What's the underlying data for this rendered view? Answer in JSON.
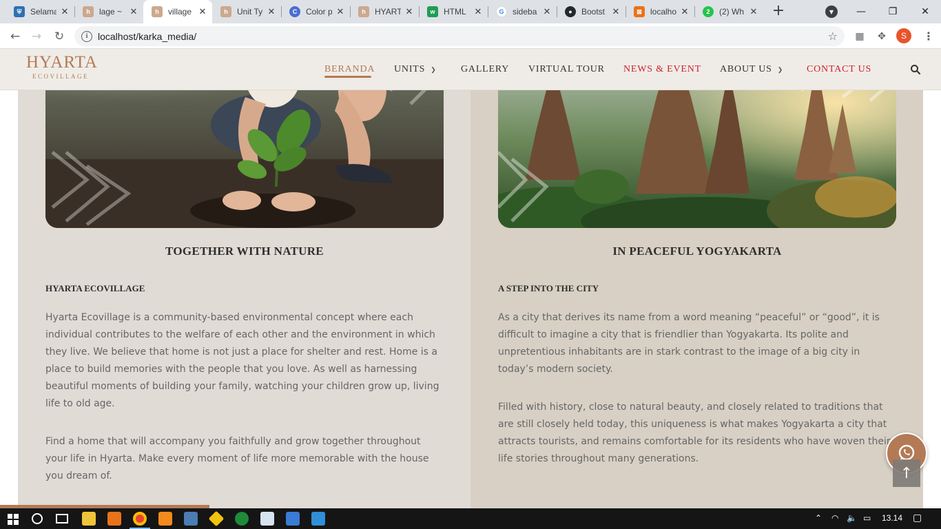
{
  "browser": {
    "tabs": [
      {
        "label": "Selama",
        "favicon_color": "#2f6fb3",
        "favicon_icon": "shield-icon"
      },
      {
        "label": "lage ~",
        "favicon_color": "#caa98f",
        "favicon_icon": "site-logo-icon"
      },
      {
        "label": "village",
        "favicon_color": "#caa98f",
        "favicon_icon": "site-logo-icon",
        "active": true
      },
      {
        "label": "Unit Ty",
        "favicon_color": "#caa98f",
        "favicon_icon": "site-logo-icon"
      },
      {
        "label": "Color p",
        "favicon_color": "#4b6cd4",
        "favicon_icon": "c-icon"
      },
      {
        "label": "HYART",
        "favicon_color": "#caa98f",
        "favicon_icon": "site-logo-icon"
      },
      {
        "label": "HTML",
        "favicon_color": "#1f9d55",
        "favicon_icon": "w3-icon"
      },
      {
        "label": "sideba",
        "favicon_color": "#4285f4",
        "favicon_icon": "google-icon"
      },
      {
        "label": "Bootst",
        "favicon_color": "#24292e",
        "favicon_icon": "github-icon"
      },
      {
        "label": "localho",
        "favicon_color": "#e8731a",
        "favicon_icon": "xampp-icon"
      },
      {
        "label": "(2) Wh",
        "favicon_color": "#25c44a",
        "favicon_icon": "whatsapp-icon"
      }
    ],
    "url": "localhost/karka_media/",
    "profile_initial": "S"
  },
  "site": {
    "logo_main": "HYARTA",
    "logo_sub": "ECOVILLAGE",
    "accent": "#b37a55",
    "nav": [
      {
        "label": "BERANDA",
        "style": "active"
      },
      {
        "label": "UNITS",
        "dropdown": true
      },
      {
        "label": "GALLERY"
      },
      {
        "label": "VIRTUAL TOUR"
      },
      {
        "label": "NEWS & EVENT",
        "style": "red"
      },
      {
        "label": "ABOUT US",
        "dropdown": true
      },
      {
        "label": "CONTACT US",
        "style": "red"
      }
    ]
  },
  "left": {
    "heading": "TOGETHER WITH NATURE",
    "subheading": "HYARTA ECOVILLAGE",
    "para1": "Hyarta Ecovillage is a community-based environmental concept where each individual contributes to the welfare of each other and the environment in which they live. We believe that home is not just a place for shelter and rest. Home is a place to build memories with the people that you love. As well as harnessing beautiful moments of building your family, watching your children grow up, living life to old age.",
    "para2": "Find a home that will accompany you faithfully and grow together throughout your life in Hyarta. Make every moment of life more memorable with the house you dream of."
  },
  "right": {
    "heading": "IN PEACEFUL YOGYAKARTA",
    "subheading": "A STEP INTO THE CITY",
    "para1": "As a city that derives its name from a word meaning “peaceful” or “good”, it is difficult to imagine a city that is friendlier than Yogyakarta. Its polite and unpretentious inhabitants are in stark contrast to the image of a big city in today’s modern society.",
    "para2": "Filled with history, close to natural beauty, and closely related to traditions that are still closely held today, this uniqueness is what makes Yogyakarta a city that attracts tourists, and remains comfortable for its residents who have woven their life stories throughout many generations."
  },
  "taskbar": {
    "time": "13.14"
  }
}
